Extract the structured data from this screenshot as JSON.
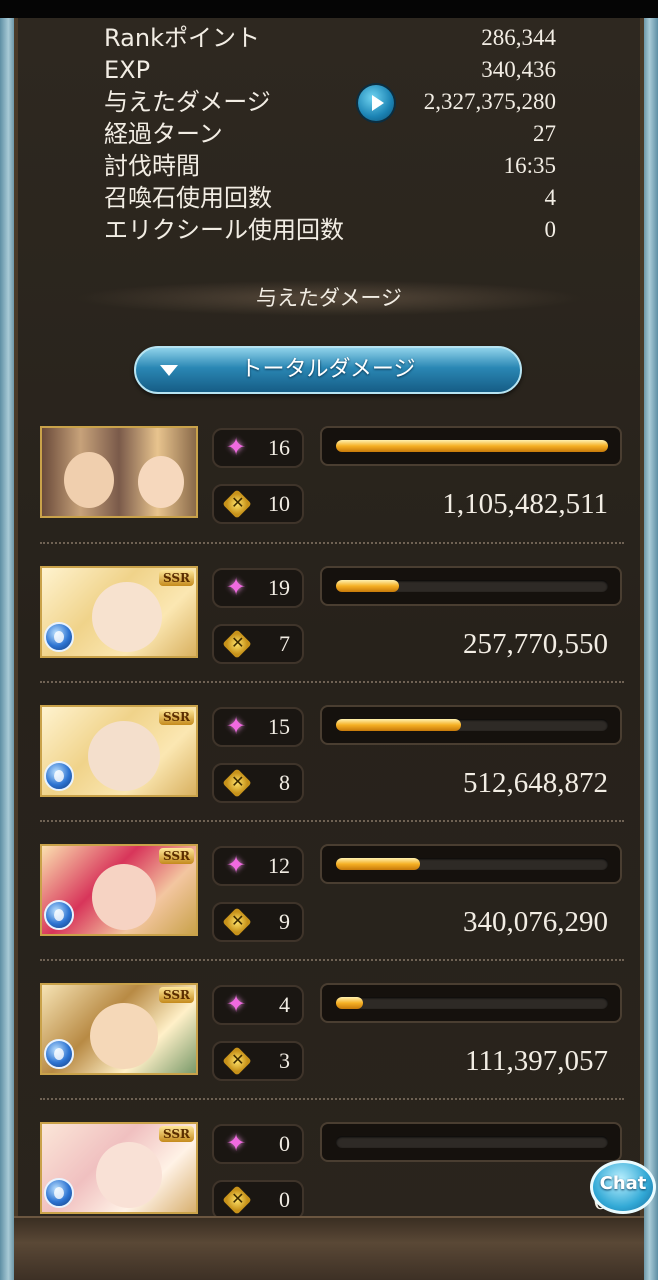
{
  "stats": [
    {
      "label": "Rankポイント",
      "value": "286,344"
    },
    {
      "label": "EXP",
      "value": "340,436"
    },
    {
      "label": "与えたダメージ",
      "value": "2,327,375,280"
    },
    {
      "label": "経過ターン",
      "value": "27"
    },
    {
      "label": "討伐時間",
      "value": "16:35"
    },
    {
      "label": "召喚石使用回数",
      "value": "4"
    },
    {
      "label": "エリクシール使用回数",
      "value": "0"
    }
  ],
  "section": {
    "heading": "与えたダメージ",
    "dropdown_label": "トータルダメージ"
  },
  "chat": {
    "label": "Chat"
  },
  "colors": {
    "accent": "#f5b024",
    "button": "#2a87b4",
    "skill": "#f06ae0"
  },
  "members": [
    {
      "portrait": "main-character-duo",
      "ssr": false,
      "skills": "16",
      "ougi": "10",
      "damage": "1,105,482,511",
      "bar_fraction": 1.0
    },
    {
      "portrait": "character-portrait",
      "ssr": true,
      "skills": "19",
      "ougi": "7",
      "damage": "257,770,550",
      "bar_fraction": 0.23
    },
    {
      "portrait": "character-portrait",
      "ssr": true,
      "skills": "15",
      "ougi": "8",
      "damage": "512,648,872",
      "bar_fraction": 0.46
    },
    {
      "portrait": "character-portrait",
      "ssr": true,
      "skills": "12",
      "ougi": "9",
      "damage": "340,076,290",
      "bar_fraction": 0.31
    },
    {
      "portrait": "character-portrait",
      "ssr": true,
      "skills": "4",
      "ougi": "3",
      "damage": "111,397,057",
      "bar_fraction": 0.1
    },
    {
      "portrait": "character-portrait",
      "ssr": true,
      "skills": "0",
      "ougi": "0",
      "damage": "0",
      "bar_fraction": 0.0
    }
  ],
  "ssr_label": "SSR"
}
